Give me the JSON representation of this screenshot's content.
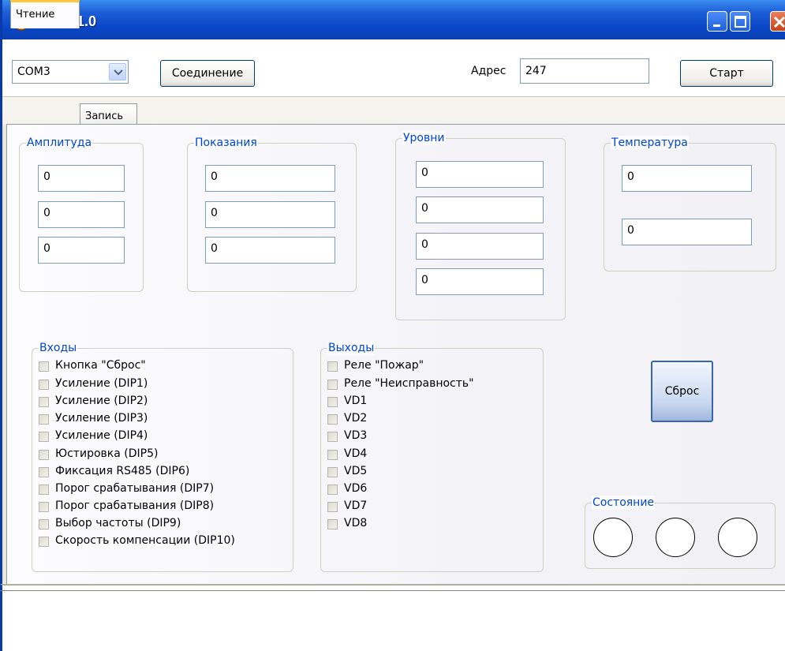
{
  "window": {
    "title": "MBT v1.0"
  },
  "toolbar": {
    "port": "COM3",
    "connect_label": "Соединение",
    "address_label": "Адрес",
    "address_value": "247",
    "start_label": "Старт"
  },
  "tabs": [
    {
      "label": "Чтение"
    },
    {
      "label": "Запись"
    }
  ],
  "groups": {
    "amplitude": {
      "title": "Амплитуда",
      "values": [
        "0",
        "0",
        "0"
      ]
    },
    "readings": {
      "title": "Показания",
      "values": [
        "0",
        "0",
        "0"
      ]
    },
    "levels": {
      "title": "Уровни",
      "values": [
        "0",
        "0",
        "0",
        "0"
      ]
    },
    "temperature": {
      "title": "Температура",
      "values": [
        "0",
        "0"
      ]
    }
  },
  "inputs": {
    "title": "Входы",
    "items": [
      "Кнопка \"Сброс\"",
      "Усиление (DIP1)",
      "Усиление (DIP2)",
      "Усиление (DIP3)",
      "Усиление (DIP4)",
      "Юстировка (DIP5)",
      "Фиксация RS485 (DIP6)",
      "Порог срабатывания (DIP7)",
      "Порог срабатывания (DIP8)",
      "Выбор частоты (DIP9)",
      "Скорость компенсации (DIP10)"
    ]
  },
  "outputs": {
    "title": "Выходы",
    "items": [
      "Реле \"Пожар\"",
      "Реле \"Неисправность\"",
      "VD1",
      "VD2",
      "VD3",
      "VD4",
      "VD5",
      "VD6",
      "VD7",
      "VD8"
    ]
  },
  "reset_label": "Сброс",
  "state": {
    "title": "Состояние"
  }
}
